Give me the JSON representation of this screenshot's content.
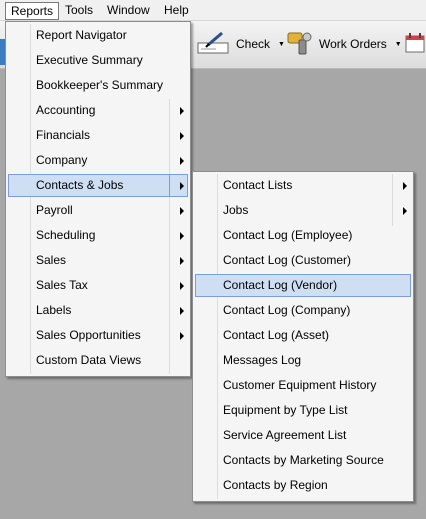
{
  "menubar": {
    "items": [
      {
        "label": "Reports"
      },
      {
        "label": "Tools"
      },
      {
        "label": "Window"
      },
      {
        "label": "Help"
      }
    ]
  },
  "toolbar": {
    "check_label": "Check",
    "work_orders_label": "Work Orders"
  },
  "reports_menu": {
    "items": [
      {
        "label": "Report Navigator"
      },
      {
        "label": "Executive Summary"
      },
      {
        "label": "Bookkeeper's Summary"
      },
      {
        "label": "Accounting"
      },
      {
        "label": "Financials"
      },
      {
        "label": "Company"
      },
      {
        "label": "Contacts & Jobs"
      },
      {
        "label": "Payroll"
      },
      {
        "label": "Scheduling"
      },
      {
        "label": "Sales"
      },
      {
        "label": "Sales Tax"
      },
      {
        "label": "Labels"
      },
      {
        "label": "Sales Opportunities"
      },
      {
        "label": "Custom Data Views"
      }
    ]
  },
  "contacts_jobs_menu": {
    "items": [
      {
        "label": "Contact Lists"
      },
      {
        "label": "Jobs"
      },
      {
        "label": "Contact Log (Employee)"
      },
      {
        "label": "Contact Log (Customer)"
      },
      {
        "label": "Contact Log (Vendor)"
      },
      {
        "label": "Contact Log (Company)"
      },
      {
        "label": "Contact Log (Asset)"
      },
      {
        "label": "Messages Log"
      },
      {
        "label": "Customer Equipment History"
      },
      {
        "label": "Equipment by Type List"
      },
      {
        "label": "Service Agreement List"
      },
      {
        "label": "Contacts by Marketing Source"
      },
      {
        "label": "Contacts by Region"
      }
    ]
  }
}
